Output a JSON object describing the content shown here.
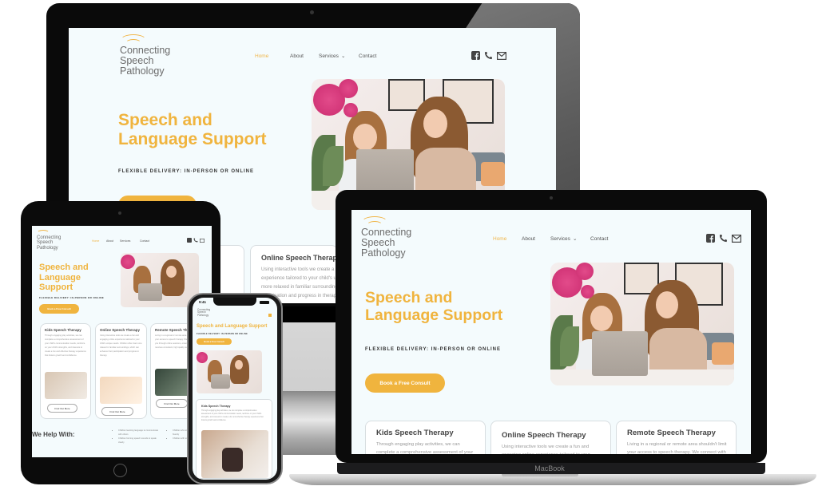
{
  "site": {
    "logo_lines": [
      "Connecting",
      "Speech",
      "Pathology"
    ],
    "nav": [
      {
        "label": "Home",
        "active": true
      },
      {
        "label": "About",
        "active": false
      },
      {
        "label": "Services",
        "active": false,
        "has_dropdown": true
      },
      {
        "label": "Contact",
        "active": false
      }
    ],
    "dropdown_glyph": "⌄",
    "social_icons": [
      "facebook-icon",
      "phone-icon",
      "mail-icon"
    ],
    "hero": {
      "title_line1": "Speech and",
      "title_line2": "Language Support",
      "title_ipad_line1": "Speech and",
      "title_ipad_line2": "Language",
      "title_ipad_line3": "Support",
      "title_phone": "Speech and Language Support",
      "subtitle": "Flexible Delivery: In-Person or Online",
      "cta": "Book a Free Consult"
    },
    "cards": [
      {
        "title": "Kids Speech Therapy",
        "text": "Through engaging play activities, we can complete a comprehensive assessment of your child's communication needs, reinforce on your child's strengths, and interests to create a fun and effective therapy experience that fosters growth and confidence.",
        "button": "Find Out More"
      },
      {
        "title": "Online Speech Therapy",
        "text": "Using interactive tools we create a fun and engaging online experience tailored to your child's unique needs. Children often feel more relaxed in familiar surroundings, which can enhance their participation and progress in therapy.",
        "button": "Find Out More"
      },
      {
        "title": "Remote Speech Therapy",
        "text": "Living in a regional or remote area shouldn't limit your access to speech therapy. We connect with you through online sessions, ensuring your child receives consistent, high quality support.",
        "button": "Find Out More"
      }
    ],
    "help": {
      "title": "We Help With:",
      "items": [
        "Children learning language to communicate with others",
        "Children forming speech sounds to speak clearly",
        "Children who stutter to communicate more fluently",
        "Children with social communication needs"
      ]
    }
  },
  "devices": {
    "macbook_label": "MacBook",
    "phone_time": "9:41",
    "apple_logo": ""
  },
  "colors": {
    "accent": "#f0b43e",
    "screen_bg": "#f4fbfd",
    "text": "#555555"
  }
}
